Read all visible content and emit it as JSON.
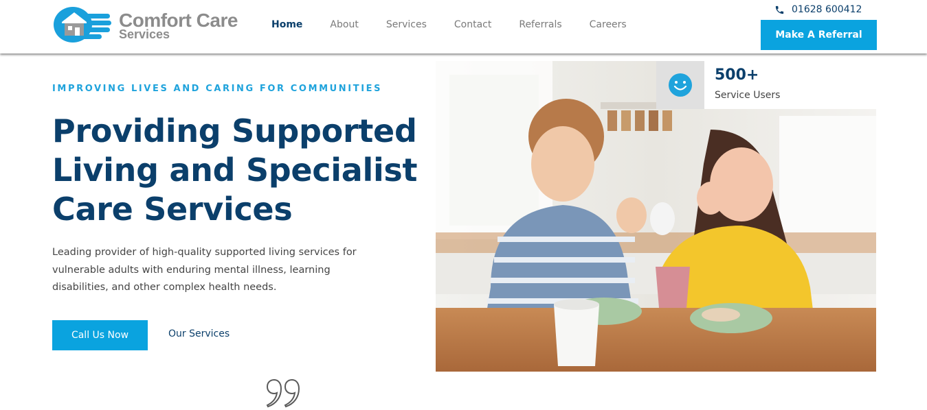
{
  "brand": {
    "name": "Comfort Care",
    "sub": "Services",
    "logo_icon": "house-hand-logo-icon",
    "primary_color": "#0aa3df",
    "navy_color": "#0b3f6b"
  },
  "nav": {
    "items": [
      {
        "label": "Home",
        "active": true
      },
      {
        "label": "About",
        "active": false
      },
      {
        "label": "Services",
        "active": false
      },
      {
        "label": "Contact",
        "active": false
      },
      {
        "label": "Referrals",
        "active": false
      },
      {
        "label": "Careers",
        "active": false
      }
    ]
  },
  "header": {
    "phone_icon": "phone-icon",
    "phone": "01628 600412",
    "cta_label": "Make A Referral"
  },
  "hero": {
    "tagline": "IMPROVING LIVES AND CARING FOR COMMUNITIES",
    "title": "Providing Supported Living and Specialist Care Services",
    "description": "Leading provider of high-quality supported living services for vulnerable adults with enduring mental illness, learning disabilities, and other complex health needs.",
    "primary_button": "Call Us Now",
    "secondary_link": "Our Services",
    "quote_icon": "quote-icon",
    "image_icon": "photo-two-people-laughing-at-kitchen-table"
  },
  "stat": {
    "icon": "smiley-icon",
    "number": "500+",
    "label": "Service Users"
  }
}
